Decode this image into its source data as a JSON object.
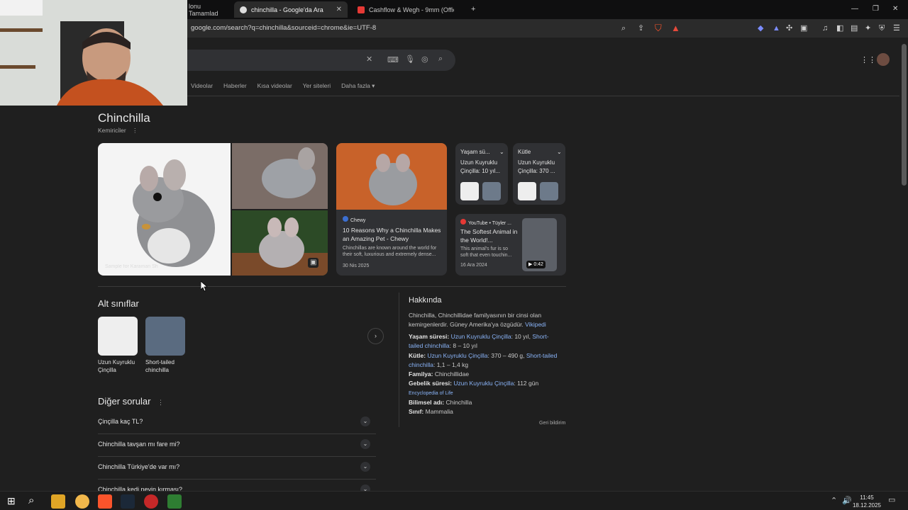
{
  "browser": {
    "tabs": [
      {
        "label": "lonu Tamamlad"
      },
      {
        "label": "chinchilla - Google'da Ara"
      },
      {
        "label": "Cashflow & Wegh - 9mm (Officia"
      }
    ],
    "url": "google.com/search?q=chinchilla&sourceid=chrome&ie=UTF-8"
  },
  "search": {
    "nav_tabs": [
      "Videolar",
      "Haberler",
      "Kısa videolar",
      "Yer siteleri",
      "Daha fazla"
    ]
  },
  "entity": {
    "title": "Chinchilla",
    "subtitle": "Kemirici̇ler",
    "image_credit": "Sample for Karaman Sh",
    "article": {
      "source": "Chewy",
      "title": "10 Reasons Why a Chinchilla Makes an Amazing Pet - Chewy",
      "snippet": "Chinchillas are known around the world for their soft, luxurious and extremely dense...",
      "date": "30 Nis 2025"
    },
    "facts": [
      {
        "head": "Yaşam sü...",
        "text": "Uzun Kuyruklu Çinçilla: 10 yıl..."
      },
      {
        "head": "Kütle",
        "text": "Uzun Kuyruklu Çinçilla: 370 ..."
      }
    ],
    "video": {
      "source": "YouTube • Tüyler ...",
      "title": "The Softest Animal in the World!...",
      "snippet": "This animal's fur is so soft that even touchin...",
      "date": "16 Ara 2024",
      "duration": "0:42"
    }
  },
  "subclasses": {
    "title": "Alt sınıflar",
    "items": [
      {
        "label": "Uzun Kuyruklu Çinçilla"
      },
      {
        "label": "Short-tailed chinchilla"
      }
    ]
  },
  "questions": {
    "title": "Diğer sorular",
    "items": [
      "Çinçilla kaç TL?",
      "Chinchilla tavşan mı fare mi?",
      "Chinchilla Türkiye'de var mı?",
      "Chinchilla kedi neyin kırması?"
    ]
  },
  "about": {
    "title": "Hakkında",
    "intro": "Chinchilla, Chinchillidae familyasının bir cinsi olan kemirgenlerdir. Güney Amerika'ya özgüdür.",
    "wiki_link": "Vikipedi",
    "lifespan_label": "Yaşam süresi:",
    "lifespan_link1": "Uzun Kuyruklu Çinçilla",
    "lifespan_val1": ": 10 yıl, ",
    "lifespan_link2": "Short-tailed chinchilla",
    "lifespan_val2": ": 8 – 10 yıl",
    "mass_label": "Kütle:",
    "mass_link1": "Uzun Kuyruklu Çinçilla",
    "mass_val1": ": 370 – 490 g, ",
    "mass_link2": "Short-tailed chinchilla",
    "mass_val2": ": 1,1 – 1,4 kg",
    "family_label": "Familya:",
    "family_val": "Chinchillidae",
    "gestation_label": "Gebelik süresi:",
    "gestation_link": "Uzun Kuyruklu Çinçilla",
    "gestation_val": ": 112 gün",
    "eol": "Encyclopedia of Life",
    "sci_label": "Bilimsel adı:",
    "sci_val": "Chinchilla",
    "class_label": "Sınıf:",
    "class_val": "Mammalia",
    "feedback": "Geri bildirim"
  },
  "taskbar": {
    "time": "11:45",
    "date": "18.12.2025"
  },
  "colors": {
    "background": "#1f1f1f",
    "card": "#303134",
    "link": "#8ab4f8"
  }
}
